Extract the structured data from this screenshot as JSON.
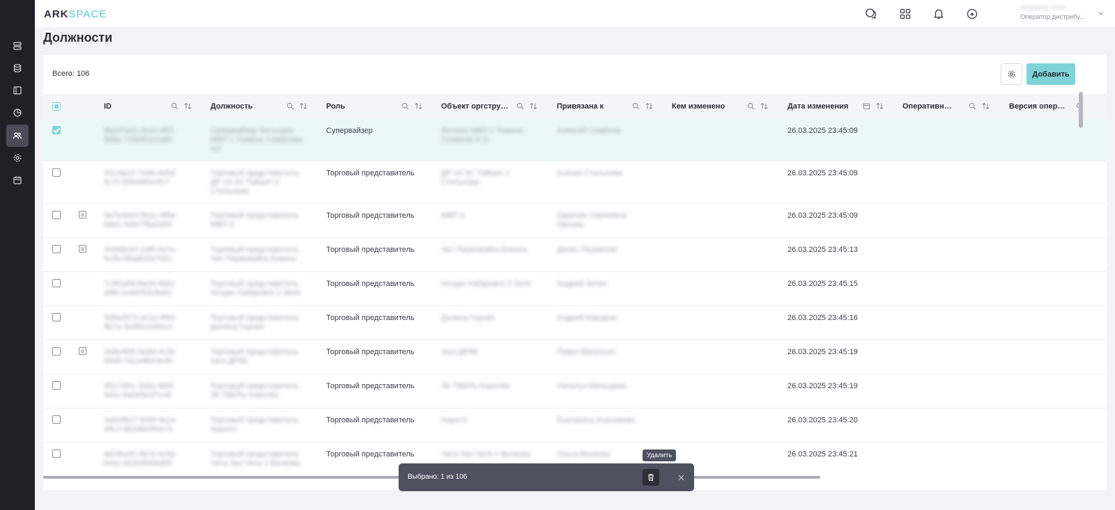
{
  "app": {
    "logo_part1": "ARK",
    "logo_part2": "SPACE"
  },
  "sidebar": {
    "items": [
      {
        "name": "sidebar-item-servers",
        "icon": "server-icon",
        "active": false
      },
      {
        "name": "sidebar-item-database",
        "icon": "database-icon",
        "active": false
      },
      {
        "name": "sidebar-item-catalog",
        "icon": "book-icon",
        "active": false
      },
      {
        "name": "sidebar-item-analytics",
        "icon": "pie-chart-icon",
        "active": false
      },
      {
        "name": "sidebar-item-users",
        "icon": "users-icon",
        "active": true
      },
      {
        "name": "sidebar-item-settings",
        "icon": "gear-icon",
        "active": false
      },
      {
        "name": "sidebar-item-calendar",
        "icon": "calendar-icon",
        "active": false
      }
    ]
  },
  "header": {
    "user_name": "Фёдоров Олег",
    "user_role": "Оператор дистрибу..."
  },
  "page": {
    "title": "Должности"
  },
  "toolbar": {
    "total_label": "Всего: 106",
    "add_label": "Добавить"
  },
  "table": {
    "columns": [
      {
        "label": "ID"
      },
      {
        "label": "Должность"
      },
      {
        "label": "Роль"
      },
      {
        "label": "Объект оргструк..."
      },
      {
        "label": "Привязана к"
      },
      {
        "label": "Кем изменено"
      },
      {
        "label": "Дата изменения"
      },
      {
        "label": "Оперативная ..."
      },
      {
        "label": "Версия операц..."
      }
    ],
    "rows": [
      {
        "id": "8b2d7a41-3ce2-4f07-9d8a-7c5b6f1e2a90",
        "position": "Супервайзер Фильтров МВП 1 Тюмень Семёнова АЭ",
        "role": "Супервайзер",
        "org": "Филиал МВП 1 Тюмень Семёнов А.Э.",
        "bound": "Алексей Семёнов",
        "date": "26.03.2025 23:45:09",
        "checked": true,
        "expandable": false
      },
      {
        "id": "4f1c9e22-7a3b-4e5d-8c1f-2b6a9d0e4f17",
        "position": "Торговый представитель ДР-18 ЗС Тайшет 2 Стельнова",
        "role": "Торговый представитель",
        "org": "ДР-18 ЗС Тайшет 2 Стельнова",
        "bound": "Ксения Стельнова",
        "date": "26.03.2025 23:45:09",
        "checked": false,
        "expandable": false
      },
      {
        "id": "9a7e3d10-5b2c-4f8a-b6e1-0d3c7f9a2e55",
        "position": "Торговый представитель МВП 3",
        "role": "Торговый представитель",
        "org": "МВП 3",
        "bound": "Карелия Сергеевна Орлова",
        "date": "26.03.2025 23:45:09",
        "checked": false,
        "expandable": true
      },
      {
        "id": "2e6b8c44-1d9f-4a7e-9c3b-5f0a8d2e7b61",
        "position": "Торговый представитель Чит Первомайск Бикина",
        "role": "Торговый представитель",
        "org": "Чит Первомайск Бикина",
        "bound": "Денис Перминов",
        "date": "26.03.2025 23:45:13",
        "checked": false,
        "expandable": true
      },
      {
        "id": "7c3f1a58-8e2d-4b6c-a9f0-1e4d7b3c8a92",
        "position": "Торговый представитель Уссури Хабаровск 2 Зеля",
        "role": "Торговый представитель",
        "org": "Уссури Хабаровск 2 Зеля",
        "bound": "Андрей Зелин",
        "date": "26.03.2025 23:45:15",
        "checked": false,
        "expandable": false
      },
      {
        "id": "5d9a2b73-4c1e-4f9d-8b7a-3e6f0c2d9b14",
        "position": "Торговый представитель Долина Горная",
        "role": "Торговый представитель",
        "org": "Долина Горная",
        "bound": "Андрей Макаров",
        "date": "26.03.2025 23:45:16",
        "checked": false,
        "expandable": false
      },
      {
        "id": "1b8e4f06-9a3d-4c2b-b5e8-7d1a4f6c0e38",
        "position": "Торговый представитель Урга ДР88",
        "role": "Торговый представитель",
        "org": "Урга ДР88",
        "bound": "Павел Васильев",
        "date": "26.03.2025 23:45:19",
        "checked": false,
        "expandable": true
      },
      {
        "id": "6f2c7d91-3e8a-4b5f-9d2c-8a0e5b1f7c46",
        "position": "Торговый представитель ЗК ТВЕРЬ Королёв",
        "role": "Торговый представитель",
        "org": "ЗК ТВЕРЬ Королёв",
        "bound": "Наталья Миньщева",
        "date": "26.03.2025 23:45:19",
        "checked": false,
        "expandable": false
      },
      {
        "id": "3a5e9b27-6d4f-4e1a-a8c3-9b2d6e0f4a73",
        "position": "Торговый представитель Кирилл",
        "role": "Торговый представитель",
        "org": "Кирилл",
        "bound": "Екатерина Анисимова",
        "date": "26.03.2025 23:45:20",
        "checked": false,
        "expandable": false
      },
      {
        "id": "8d1f6a35-2b7e-4c9d-b4a1-6e3c9f2b8d05",
        "position": "Торговый представитель Чита Зап Чита 1 Волкова",
        "role": "Торговый представитель",
        "org": "Чита Зап Чита 1 Волкова",
        "bound": "Ольга Волкова",
        "date": "26.03.2025 23:45:21",
        "checked": false,
        "expandable": false
      }
    ]
  },
  "selection": {
    "text": "Выбрано: 1 из 106",
    "delete_tooltip": "Удалить"
  },
  "colors": {
    "accent": "#7fd3d6",
    "sidebar": "#1f2127",
    "toast": "#4e5160"
  }
}
